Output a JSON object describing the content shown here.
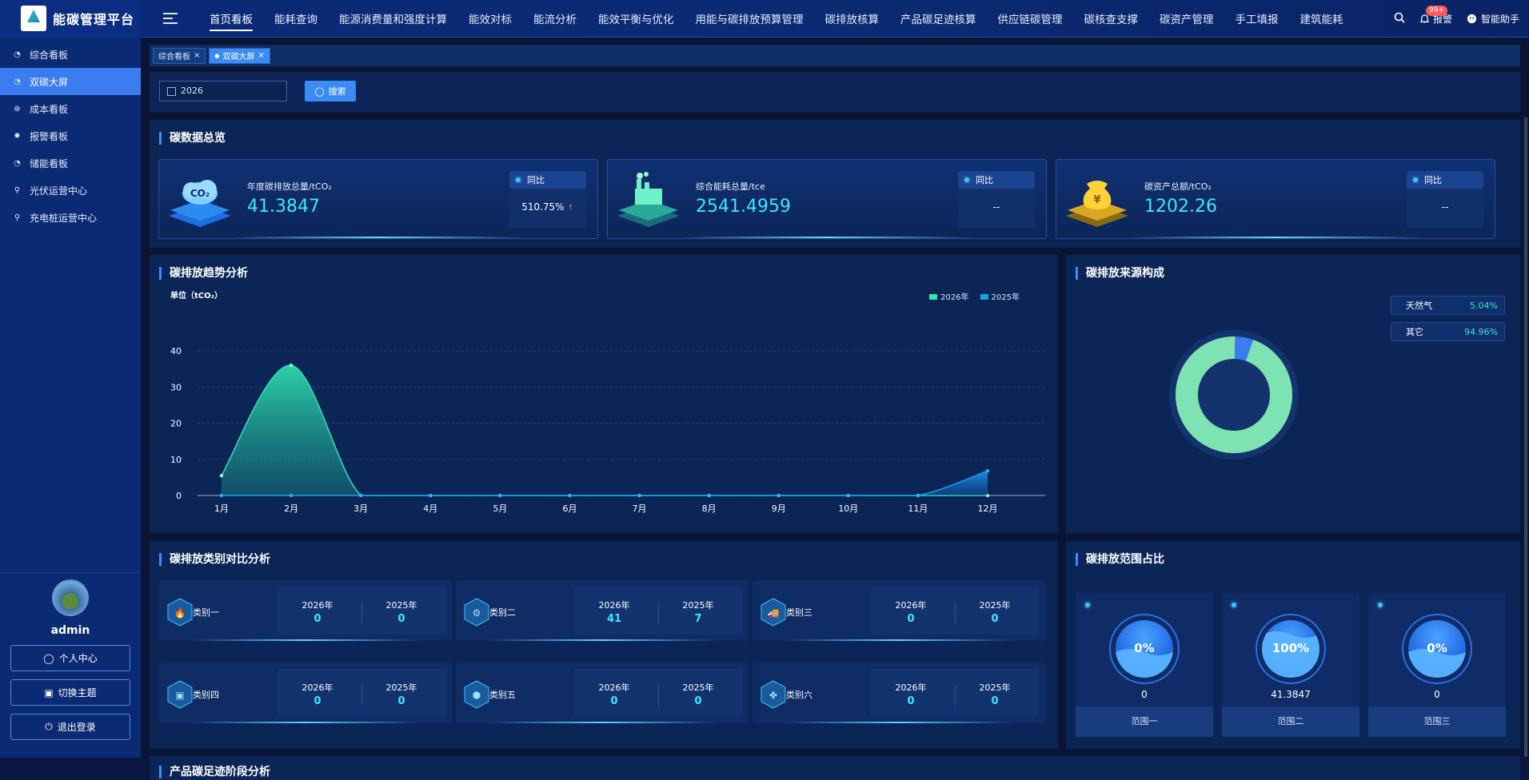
{
  "app": {
    "title": "能碳管理平台"
  },
  "nav": [
    "首页看板",
    "能耗查询",
    "能源消费量和强度计算",
    "能效对标",
    "能流分析",
    "能效平衡与优化",
    "用能与碳排放预算管理",
    "碳排放核算",
    "产品碳足迹核算",
    "供应链碳管理",
    "碳核查支撑",
    "碳资产管理",
    "手工填报",
    "建筑能耗"
  ],
  "top_right": {
    "notify_badge": "99+",
    "notify_label": "报警",
    "assistant_label": "智能助手"
  },
  "sidebar": {
    "items": [
      {
        "label": "综合看板",
        "icon": "dashboard-icon"
      },
      {
        "label": "双碳大屏",
        "icon": "dashboard-icon"
      },
      {
        "label": "成本看板",
        "icon": "coin-icon"
      },
      {
        "label": "报警看板",
        "icon": "bug-icon"
      },
      {
        "label": "储能看板",
        "icon": "dashboard-icon"
      },
      {
        "label": "光伏运营中心",
        "icon": "person-icon"
      },
      {
        "label": "充电桩运营中心",
        "icon": "person-icon"
      }
    ]
  },
  "user": {
    "name": "admin",
    "buttons": [
      "个人中心",
      "切换主题",
      "退出登录"
    ]
  },
  "tabs": [
    {
      "label": "综合看板"
    },
    {
      "label": "双碳大屏"
    }
  ],
  "filter": {
    "date": "2026",
    "search_label": "搜索"
  },
  "overview": {
    "title": "碳数据总览",
    "kpis": [
      {
        "label": "年度碳排放总量/tCO₂",
        "value": "41.3847",
        "yoy_label": "同比",
        "yoy": "510.75%",
        "icon": "co2-cloud-icon"
      },
      {
        "label": "综合能耗总量/tce",
        "value": "2541.4959",
        "yoy_label": "同比",
        "yoy": "--",
        "icon": "factory-icon"
      },
      {
        "label": "碳资产总额/tCO₂",
        "value": "1202.26",
        "yoy_label": "同比",
        "yoy": "--",
        "icon": "money-bag-icon"
      }
    ]
  },
  "trend": {
    "title": "碳排放趋势分析",
    "unit": "单位（tCO₂）"
  },
  "chart_data": [
    {
      "type": "area",
      "title": "碳排放趋势分析",
      "ylabel": "单位（tCO₂）",
      "x": [
        "1月",
        "2月",
        "3月",
        "4月",
        "5月",
        "6月",
        "7月",
        "8月",
        "9月",
        "10月",
        "11月",
        "12月"
      ],
      "ylim": [
        0,
        40
      ],
      "yticks": [
        0,
        10,
        20,
        30,
        40
      ],
      "legend": "top-right",
      "grid": true,
      "series": [
        {
          "name": "2026年",
          "color": "#2fe6b0",
          "values": [
            5.5,
            36,
            0,
            0,
            0,
            0,
            0,
            0,
            0,
            0,
            0,
            0
          ]
        },
        {
          "name": "2025年",
          "color": "#1aa0e6",
          "values": [
            0,
            0,
            0,
            0,
            0,
            0,
            0,
            0,
            0,
            0,
            0,
            6.8
          ]
        }
      ]
    },
    {
      "type": "pie",
      "title": "碳排放来源构成",
      "categories": [
        "天然气",
        "其它"
      ],
      "values": [
        5.04,
        94.96
      ],
      "labels": [
        "5.04%",
        "94.96%"
      ],
      "colors": [
        "#3b7cf0",
        "#7de3b2"
      ]
    }
  ],
  "source": {
    "title": "碳排放来源构成",
    "items": [
      {
        "label": "天然气",
        "value": "5.04%"
      },
      {
        "label": "其它",
        "value": "94.96%"
      }
    ]
  },
  "category": {
    "title": "碳排放类别对比分析",
    "year_a": "2026年",
    "year_b": "2025年",
    "items": [
      {
        "name": "类别一",
        "a": "0",
        "b": "0",
        "icon": "fire-icon"
      },
      {
        "name": "类别二",
        "a": "41",
        "b": "7",
        "icon": "machine-icon"
      },
      {
        "name": "类别三",
        "a": "0",
        "b": "0",
        "icon": "truck-icon"
      },
      {
        "name": "类别四",
        "a": "0",
        "b": "0",
        "icon": "box-icon"
      },
      {
        "name": "类别五",
        "a": "0",
        "b": "0",
        "icon": "cube-icon"
      },
      {
        "name": "类别六",
        "a": "0",
        "b": "0",
        "icon": "clover-icon"
      }
    ]
  },
  "range": {
    "title": "碳排放范围占比",
    "items": [
      {
        "name": "范围一",
        "pct": "0%",
        "value": "0",
        "fill": 0
      },
      {
        "name": "范围二",
        "pct": "100%",
        "value": "41.3847",
        "fill": 1
      },
      {
        "name": "范围三",
        "pct": "0%",
        "value": "0",
        "fill": 0
      }
    ]
  },
  "footprint": {
    "title": "产品碳足迹阶段分析"
  }
}
